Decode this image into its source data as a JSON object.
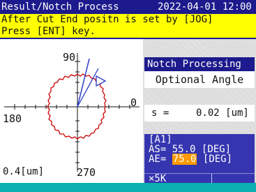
{
  "header": {
    "title": "Result/Notch Process",
    "datetime": "2022-04-01 12:00"
  },
  "message": {
    "line1": "After Cut End positn is set by [JOG]",
    "line2": "Press [ENT] key."
  },
  "plot": {
    "label_90": "90",
    "label_0": "0",
    "label_180": "180",
    "label_270": "270",
    "scale": "0.4[um]"
  },
  "mode": {
    "title": "Notch Processing",
    "subtitle": "Optional Angle"
  },
  "step": {
    "label": "s =",
    "value": "0.02 [um]"
  },
  "angles": {
    "section": "[A1]",
    "as_label": "AS=",
    "as_value": "55.0",
    "as_unit": "[DEG]",
    "ae_label": "AE=",
    "ae_value": "75.0",
    "ae_unit": "[DEG]",
    "magnification": "×5K"
  },
  "colors": {
    "title_bar": "#1c1a8c",
    "message_bg": "#ffff00",
    "trace": "#cc0000",
    "cut_line": "#2a3cc8",
    "highlight": "#ff9a00",
    "footer": "#0ab0b0"
  }
}
